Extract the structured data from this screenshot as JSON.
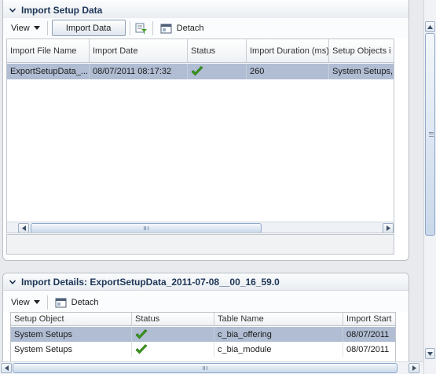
{
  "import_setup_panel": {
    "title": "Import Setup Data",
    "toolbar": {
      "view_label": "View",
      "import_label": "Import Data",
      "detach_label": "Detach"
    },
    "columns": [
      "Import File Name",
      "Import Date",
      "Status",
      "Import Duration (ms)",
      "Setup Objects i"
    ],
    "rows": [
      {
        "file": "ExportSetupData_...",
        "date": "08/07/2011 08:17:32",
        "status": "success",
        "duration": "260",
        "objects": "System Setups,"
      }
    ]
  },
  "import_details_panel": {
    "title": "Import Details: ExportSetupData_2011-07-08__00_16_59.0",
    "toolbar": {
      "view_label": "View",
      "detach_label": "Detach"
    },
    "columns": [
      "Setup Object",
      "Status",
      "Table Name",
      "Import Start"
    ],
    "rows": [
      {
        "object": "System Setups",
        "status": "success",
        "table": "c_bia_offering",
        "start": "08/07/2011"
      },
      {
        "object": "System Setups",
        "status": "success",
        "table": "c_bia_module",
        "start": "08/07/2011"
      }
    ]
  },
  "icons": {
    "disclosure": "chevron-down-icon",
    "status": "green-check-icon",
    "filter": "query-filter-icon",
    "detach": "detach-window-icon",
    "menu": "dropdown-arrow-icon"
  },
  "colors": {
    "selected_row": "#b0bdd3",
    "title_text": "#1d3557",
    "check_green": "#3a9a1c"
  }
}
